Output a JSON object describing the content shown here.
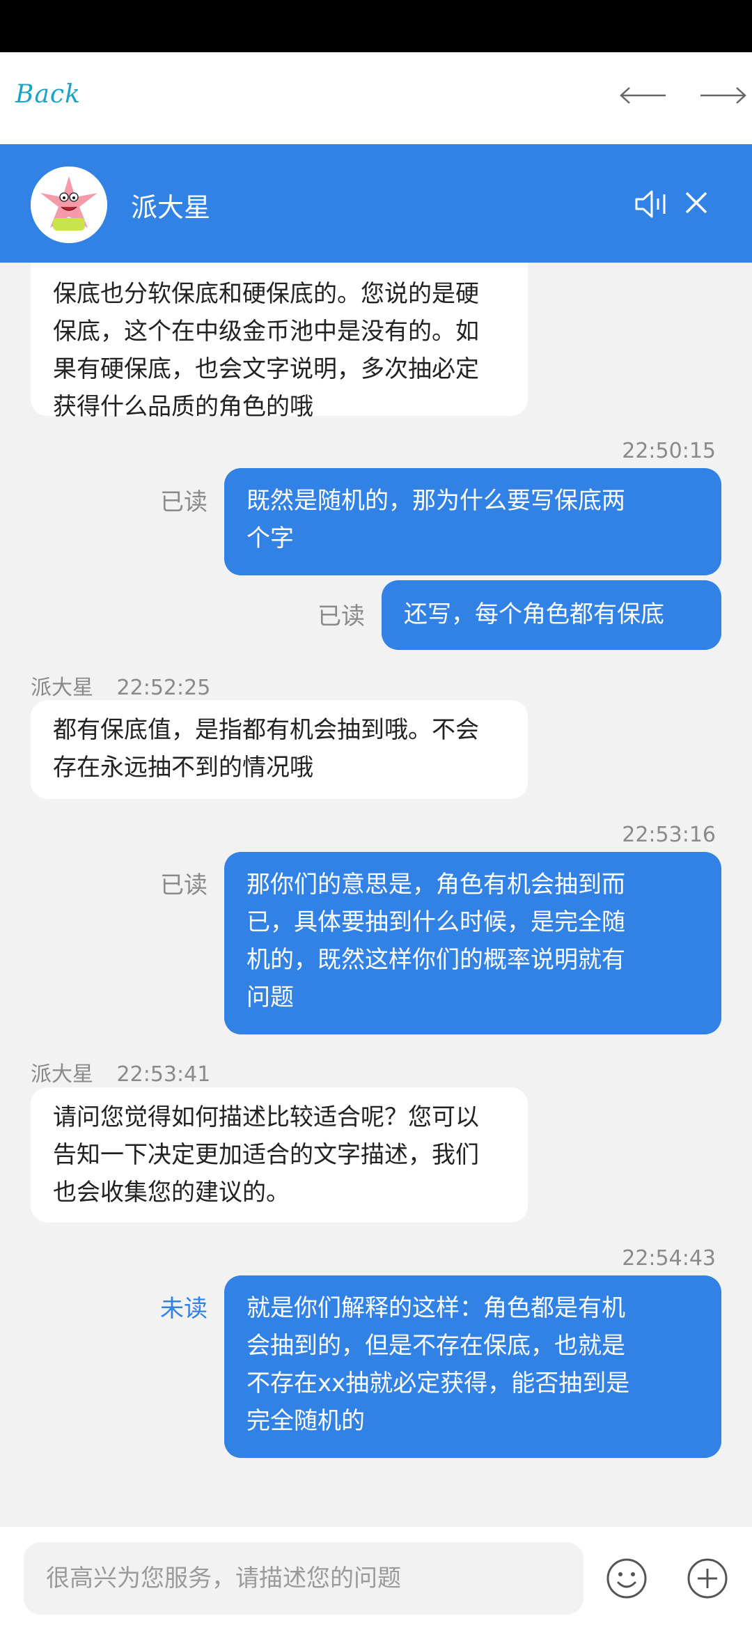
{
  "nav": {
    "back_label": "Back"
  },
  "header": {
    "agent_name": "派大星"
  },
  "messages": {
    "m1": {
      "lines": [
        "保底也分软保底和硬保底的。您说的是硬",
        "保底，这个在中级金币池中是没有的。如",
        "果有硬保底，也会文字说明，多次抽必定",
        "获得什么品质的角色的哦"
      ]
    },
    "m2": {
      "time": "22:50:15",
      "status": "已读",
      "lines": [
        "既然是随机的，那为什么要写保底两",
        "个字"
      ]
    },
    "m3": {
      "status": "已读",
      "lines": [
        "还写，每个角色都有保底"
      ]
    },
    "m4": {
      "sender": "派大星",
      "time": "22:52:25",
      "lines": [
        "都有保底值，是指都有机会抽到哦。不会",
        "存在永远抽不到的情况哦"
      ]
    },
    "m5": {
      "time": "22:53:16",
      "status": "已读",
      "lines": [
        "那你们的意思是，角色有机会抽到而",
        "已，具体要抽到什么时候，是完全随",
        "机的，既然这样你们的概率说明就有",
        "问题"
      ]
    },
    "m6": {
      "sender": "派大星",
      "time": "22:53:41",
      "lines": [
        "请问您觉得如何描述比较适合呢？您可以",
        "告知一下决定更加适合的文字描述，我们",
        "也会收集您的建议的。"
      ]
    },
    "m7": {
      "time": "22:54:43",
      "status": "未读",
      "lines": [
        "就是你们解释的这样：角色都是有机",
        "会抽到的，但是不存在保底，也就是",
        "不存在xx抽就必定获得，能否抽到是",
        "完全随机的"
      ]
    }
  },
  "input": {
    "placeholder": "很高兴为您服务，请描述您的问题"
  },
  "colors": {
    "accent": "#3282e6",
    "back_link": "#1aa3c8",
    "background": "#f2f2f2"
  },
  "icons": {
    "nav": [
      "arrow-left-icon",
      "arrow-right-icon"
    ],
    "header": [
      "speaker-icon",
      "close-icon"
    ],
    "input": [
      "emoji-icon",
      "plus-icon"
    ]
  }
}
